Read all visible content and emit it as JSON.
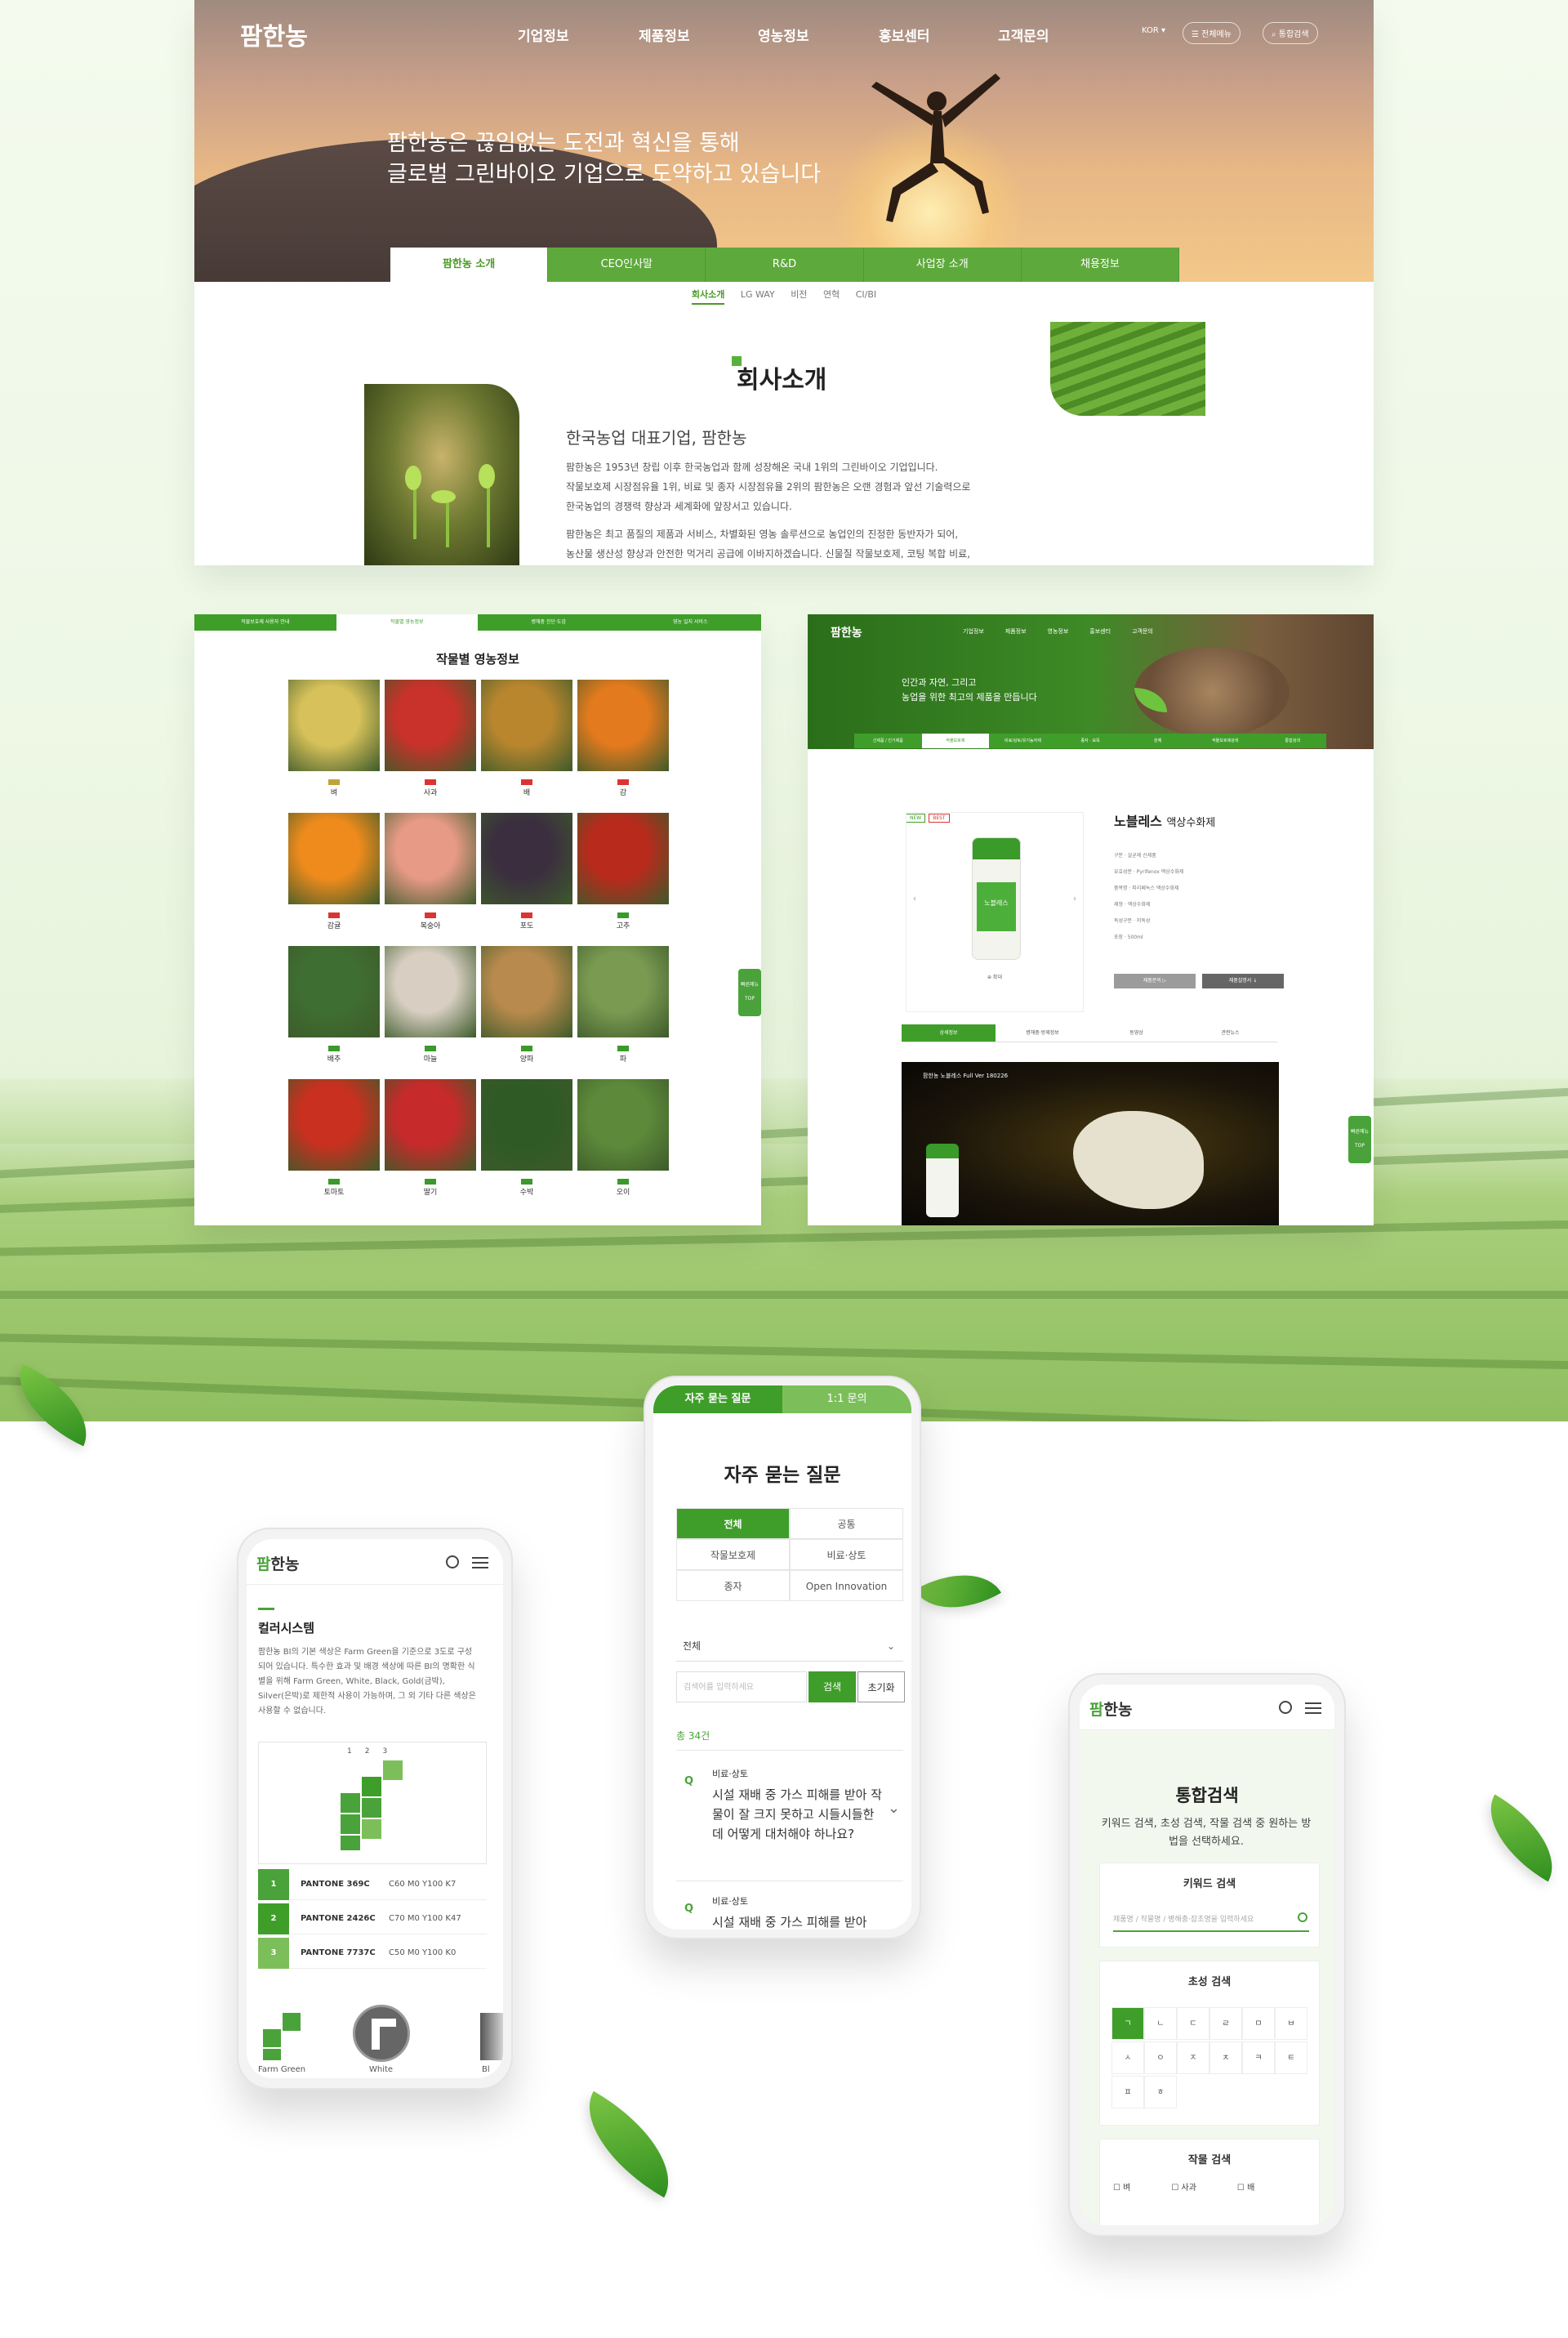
{
  "site": {
    "brand_prefix": "팜",
    "brand_rest": "한농",
    "brand_full": "팜한농"
  },
  "hero": {
    "nav": [
      "기업정보",
      "제품정보",
      "영농정보",
      "홍보센터",
      "고객문의"
    ],
    "lang": "KOR ▾",
    "menu_btn": "☰ 전체메뉴",
    "search_btn": "⌕ 통합검색",
    "headline_1": "팜한농은 끊임없는 도전과 혁신을 통해",
    "headline_2": "글로벌 그린바이오 기업으로 도약하고 있습니다",
    "tabs": [
      "팜한농 소개",
      "CEO인사말",
      "R&D",
      "사업장 소개",
      "채용정보"
    ],
    "subnav": [
      "회사소개",
      "LG WAY",
      "비전",
      "연혁",
      "CI/BI"
    ],
    "section_title": "회사소개",
    "subtitle": "한국농업 대표기업, 팜한농",
    "para_1": "팜한농은 1953년 창립 이후 한국농업과 함께 성장해온 국내 1위의 그린바이오 기업입니다.",
    "para_2": "작물보호제 시장점유율 1위, 비료 및 종자 시장점유율 2위의 팜한농은 오랜 경험과 앞선 기술력으로",
    "para_3": "한국농업의 경쟁력 향상과 세계화에 앞장서고 있습니다.",
    "para_4": "팜한농은 최고 품질의 제품과 서비스, 차별화된 영농 솔루션으로 농업인의 진정한 동반자가 되어,",
    "para_5": "농산물 생산성 향상과 안전한 먹거리 공급에 이바지하겠습니다. 신물질 작물보호제, 코팅 복합 비료,"
  },
  "crops": {
    "tabs": [
      "작물보호제 사용자 안내",
      "작물별 영농정보",
      "병해충 진단·도감",
      "영농 일지 서비스"
    ],
    "title": "작물별 영농정보",
    "items": [
      {
        "name": "벼",
        "badge": "y",
        "color": "#d7c15a"
      },
      {
        "name": "사과",
        "badge": "r",
        "color": "#c8322a"
      },
      {
        "name": "배",
        "badge": "r",
        "color": "#b9862e"
      },
      {
        "name": "감",
        "badge": "r",
        "color": "#e47a1e"
      },
      {
        "name": "감귤",
        "badge": "r",
        "color": "#ef8b1c"
      },
      {
        "name": "복숭아",
        "badge": "r",
        "color": "#e79a86"
      },
      {
        "name": "포도",
        "badge": "r",
        "color": "#3b2f3f"
      },
      {
        "name": "고추",
        "badge": "g",
        "color": "#b82a1c"
      },
      {
        "name": "배추",
        "badge": "g",
        "color": "#3f6e32"
      },
      {
        "name": "마늘",
        "badge": "g",
        "color": "#d8cfc2"
      },
      {
        "name": "양파",
        "badge": "g",
        "color": "#b88a4d"
      },
      {
        "name": "파",
        "badge": "g",
        "color": "#7a9a52"
      },
      {
        "name": "토마토",
        "badge": "g",
        "color": "#c9301f"
      },
      {
        "name": "딸기",
        "badge": "g",
        "color": "#c72a2a"
      },
      {
        "name": "수박",
        "badge": "g",
        "color": "#2f5a25"
      },
      {
        "name": "오이",
        "badge": "g",
        "color": "#5d8a3a"
      }
    ],
    "side_btn": "빠른메뉴",
    "top_btn": "TOP"
  },
  "product": {
    "banner_text_1": "인간과 자연, 그리고",
    "banner_text_2": "농업을 위한 최고의 제품을 만듭니다",
    "nav": [
      "기업정보",
      "제품정보",
      "영농정보",
      "홍보센터",
      "고객문의"
    ],
    "subtabs": [
      "신제품 / 인기제품",
      "작물보호제",
      "비료/상토/유기농자재",
      "종자 · 묘목",
      "원예",
      "작물보호제검색",
      "통합검색"
    ],
    "badges": [
      "NEW",
      "BEST"
    ],
    "name": "노블레스",
    "name_suffix": "액상수화제",
    "zoom": "⊕ 확대",
    "info": [
      "구분 · 살균제 신제품",
      "유효성분 · Pyrifenox 액상수화제",
      "품목명 · 피리페녹스 액상수화제",
      "제형 · 액상수화제",
      "독성구분 · 저독성",
      "포장 · 500ml"
    ],
    "btn_label": "제품문의 ▷",
    "btn_manual": "제품설명서 ↓",
    "tabs": [
      "상세정보",
      "병해충·방제정보",
      "동영상",
      "관련뉴스"
    ],
    "video_title": "팜한농 노블레스 Full Ver 180226",
    "label_on_bottle": "노블레스"
  },
  "faq": {
    "tabs": [
      "자주 묻는 질문",
      "1:1 문의"
    ],
    "title": "자주 묻는 질문",
    "categories": [
      "전체",
      "공통",
      "작물보호제",
      "비료·상토",
      "종자",
      "Open Innovation"
    ],
    "select": "전체",
    "input_placeholder": "검색어를 입력하세요",
    "search_btn": "검색",
    "reset_btn": "초기화",
    "count": "총 34건",
    "items": [
      {
        "q": "Q",
        "cat": "비료·상토",
        "text": "시설 재배 중 가스 피해를 받아 작물이 잘 크지 못하고 시들시들한데 어떻게 대처해야 하나요?"
      },
      {
        "q": "Q",
        "cat": "비료·상토",
        "text": "시설 재배 중 가스 피해를 받아"
      }
    ]
  },
  "color_system": {
    "title": "컬러시스템",
    "desc": "팜한농 BI의 기본 색상은 Farm Green을 기준으로 3도로 구성되어 있습니다. 특수한 효과 및 배경 색상에 따른 BI의 명확한 식별을 위해 Farm Green, White, Black, Gold(금박), Silver(은박)로 제한적 사용이 가능하며, 그 외 기타 다른 색상은 사용할 수 없습니다.",
    "chip_nums": [
      "1",
      "2",
      "3"
    ],
    "pantones": [
      {
        "num": "1",
        "name": "PANTONE 369C",
        "cmyk": "C60  M0  Y100  K7"
      },
      {
        "num": "2",
        "name": "PANTONE 2426C",
        "cmyk": "C70  M0  Y100  K47"
      },
      {
        "num": "3",
        "name": "PANTONE 7737C",
        "cmyk": "C50  M0  Y100  K0"
      }
    ],
    "swatches": [
      "Farm Green",
      "White",
      "Bl"
    ]
  },
  "search": {
    "title": "통합검색",
    "desc": "키워드 검색, 초성 검색, 작물 검색 중 원하는 방법을 선택하세요.",
    "keyword_title": "키워드 검색",
    "keyword_placeholder": "제품명 / 작물명 / 병해충·잡초명을 입력하세요",
    "initial_title": "초성 검색",
    "initials": [
      "ㄱ",
      "ㄴ",
      "ㄷ",
      "ㄹ",
      "ㅁ",
      "ㅂ",
      "ㅅ",
      "ㅇ",
      "ㅈ",
      "ㅊ",
      "ㅋ",
      "ㅌ",
      "ㅍ",
      "ㅎ"
    ],
    "crop_title": "작물 검색",
    "crops": [
      "벼",
      "사과",
      "배"
    ]
  },
  "colors": {
    "brand_green": "#3f9e2a",
    "light_green": "#7cbf5a"
  }
}
